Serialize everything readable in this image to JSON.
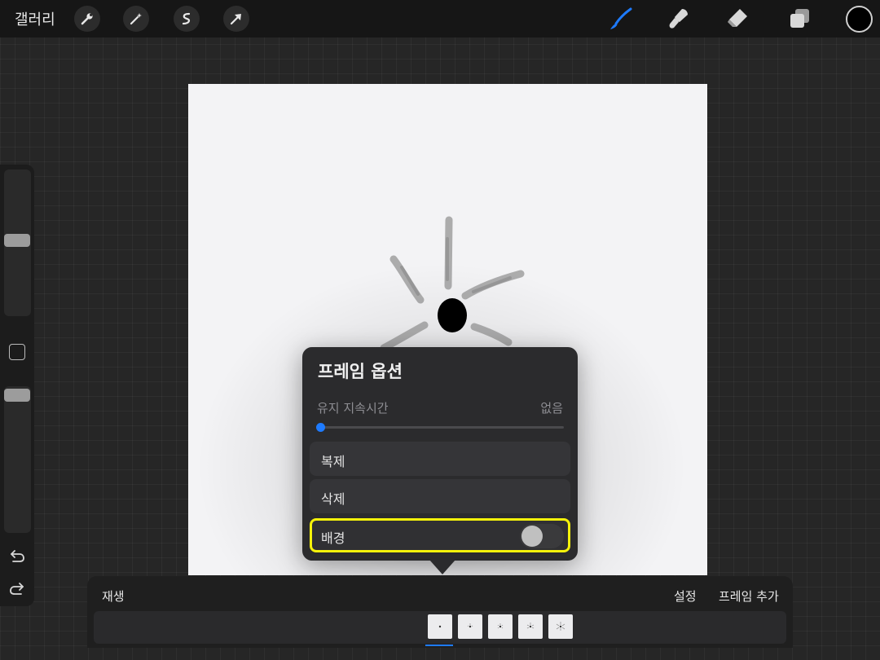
{
  "topbar": {
    "gallery_label": "갤러리",
    "action_icons": [
      "wrench-icon",
      "magic-wand-icon",
      "selection-icon",
      "transform-arrow-icon"
    ],
    "tools": [
      "brush-icon",
      "smudge-icon",
      "eraser-icon",
      "layers-icon"
    ],
    "active_tool": "brush-icon",
    "accent_color": "#1e7bff",
    "current_color": "#000000"
  },
  "sidebar": {
    "brush_size_level": 0.5,
    "opacity_level": 0.95,
    "icons": [
      "modify-square-icon",
      "undo-icon",
      "redo-icon"
    ]
  },
  "popover": {
    "title": "프레임 옵션",
    "hold_duration_label": "유지 지속시간",
    "hold_duration_value": "없음",
    "hold_duration_level": 0,
    "duplicate_label": "복제",
    "delete_label": "삭제",
    "background_label": "배경",
    "background_enabled": false,
    "highlight_color": "#f5f20a"
  },
  "animation_bar": {
    "play_label": "재생",
    "settings_label": "설정",
    "add_frame_label": "프레임 추가",
    "frame_count": 5,
    "selected_frame": 1
  }
}
